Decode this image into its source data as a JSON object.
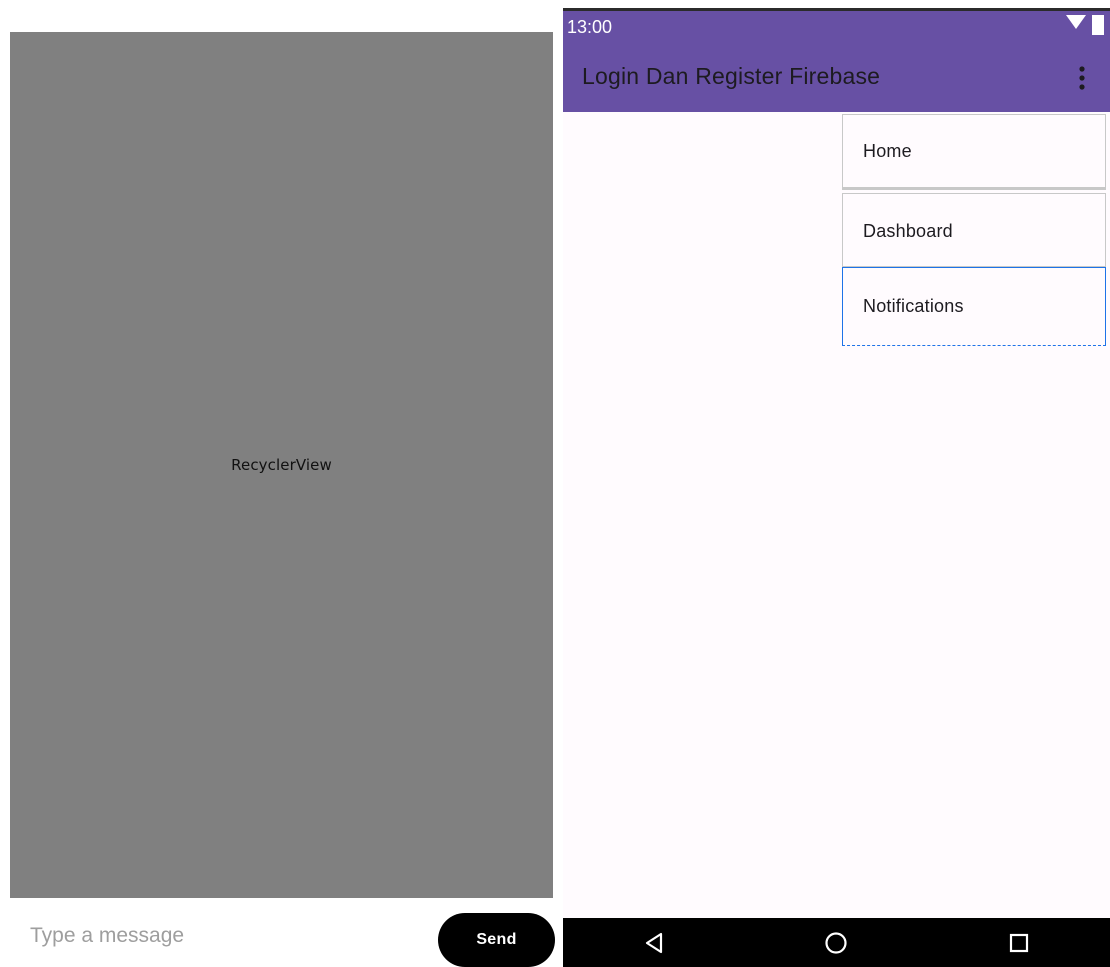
{
  "editor": {
    "recycler_label": "RecyclerView",
    "message_placeholder": "Type a message",
    "send_label": "Send"
  },
  "phone": {
    "status_time": "13:00",
    "status_icons": [
      "wifi-icon",
      "battery-icon"
    ],
    "app_title": "Login Dan Register Firebase",
    "overflow_icon": "more-vert-icon",
    "menu": {
      "items": [
        {
          "label": "Home"
        },
        {
          "label": "Dashboard"
        },
        {
          "label": "Notifications"
        }
      ]
    },
    "nav_buttons": [
      "back-icon",
      "home-icon",
      "recents-icon"
    ]
  },
  "colors": {
    "primary": "#6750a4",
    "surface": "#fffbfe",
    "recycler_bg": "#808080",
    "send_button_bg": "#000000",
    "selection_outline": "#1e73e8"
  }
}
